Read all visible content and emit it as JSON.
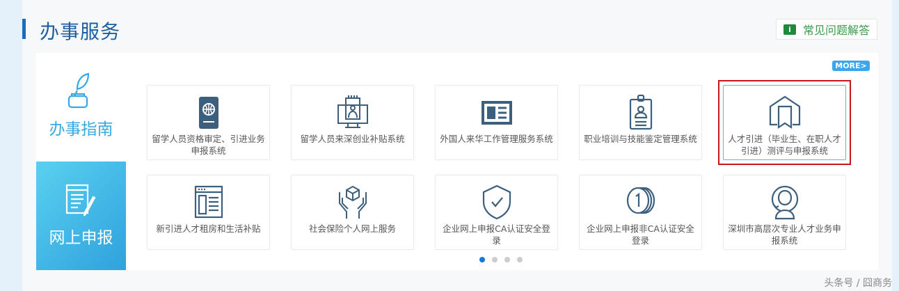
{
  "header": {
    "title": "办事服务",
    "faq_label": "常见问题解答",
    "faq_icon": "info-chat-icon"
  },
  "sidebar": {
    "items": [
      {
        "label": "办事指南",
        "icon": "quill-ink-icon"
      },
      {
        "label": "网上申报",
        "icon": "form-pen-icon"
      }
    ]
  },
  "more_label": "MORE>",
  "cards": [
    {
      "label": "留学人员资格审定、引进业务申报系统",
      "icon": "passport-icon"
    },
    {
      "label": "留学人员来深创业补贴系统",
      "icon": "monitor-person-icon"
    },
    {
      "label": "外国人来华工作管理服务系统",
      "icon": "id-card-icon"
    },
    {
      "label": "职业培训与技能鉴定管理系统",
      "icon": "badge-icon"
    },
    {
      "label": "人才引进（毕业生、在职人才引进）测评与申报系统",
      "icon": "house-bookmark-icon"
    },
    {
      "label": "新引进人才租房和生活补贴",
      "icon": "newspaper-icon"
    },
    {
      "label": "社会保险个人网上服务",
      "icon": "hands-cube-icon"
    },
    {
      "label": "企业网上申报CA认证安全登录",
      "icon": "shield-check-icon"
    },
    {
      "label": "企业网上申报非CA认证安全登录",
      "icon": "coins-icon"
    },
    {
      "label": "深圳市高层次专业人才业务申报系统",
      "icon": "person-head-icon"
    }
  ],
  "pagination": {
    "current": 1,
    "total": 4
  },
  "watermark": "头条号 / 囧商务",
  "colors": {
    "accent": "#1a6cb8",
    "highlight": "#c8161d",
    "icon": "#3d5f7e"
  }
}
